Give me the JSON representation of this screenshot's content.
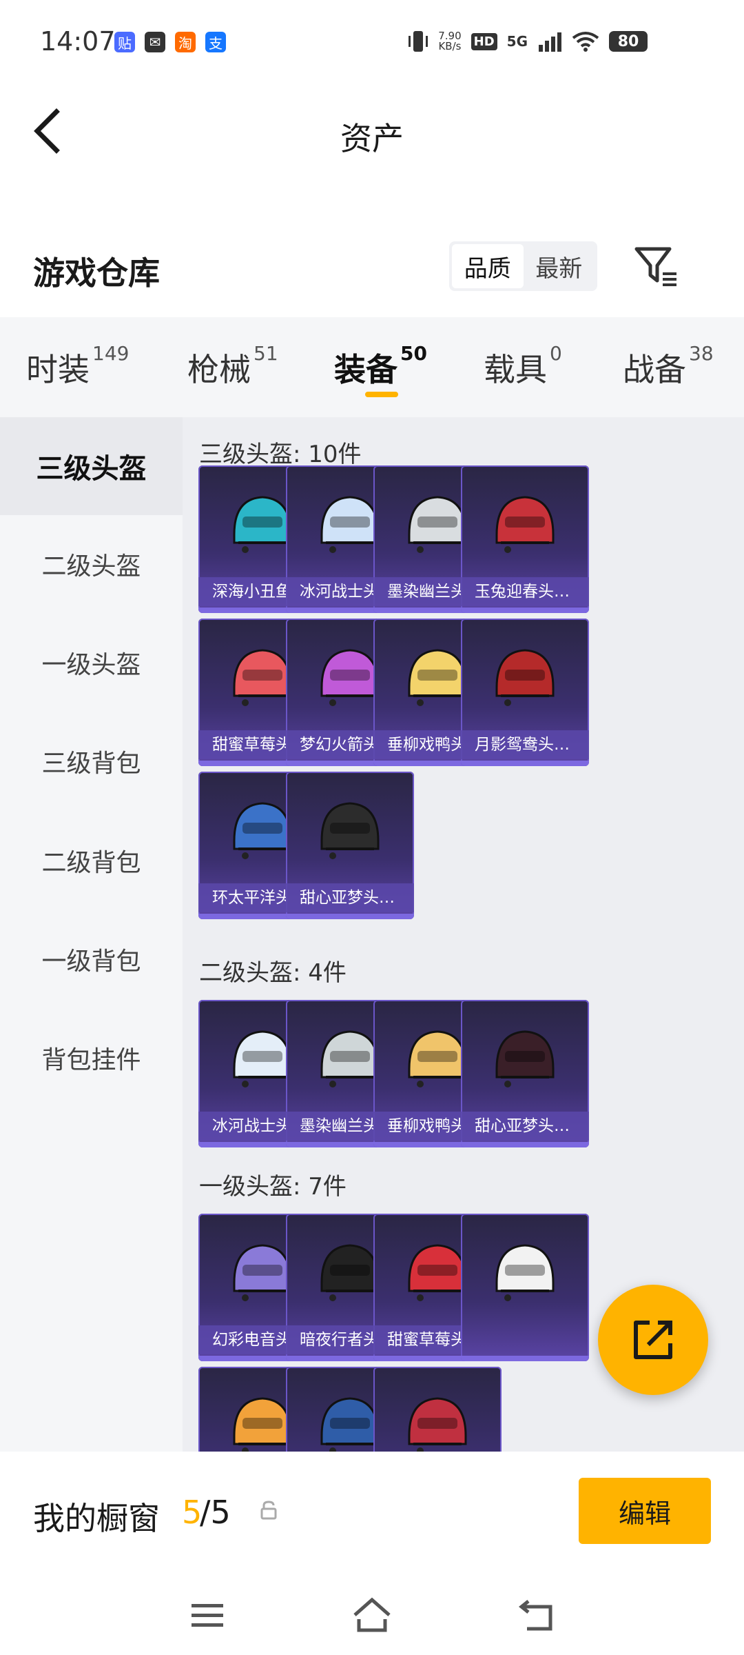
{
  "status_bar": {
    "time": "14:07",
    "apps": [
      {
        "icon": "tieba-icon",
        "color": "#4b6bff",
        "glyph": "贴"
      },
      {
        "icon": "mail-icon",
        "color": "#333333",
        "glyph": "✉"
      },
      {
        "icon": "taobao-icon",
        "color": "#ff6a00",
        "glyph": "淘"
      },
      {
        "icon": "alipay-icon",
        "color": "#1677ff",
        "glyph": "支"
      }
    ],
    "net_speed_value": "7.90",
    "net_speed_unit": "KB/s",
    "hd": "HD",
    "network": "5G",
    "battery": "80"
  },
  "header": {
    "title": "资产"
  },
  "warehouse": {
    "title": "游戏仓库",
    "sort_options": [
      "品质",
      "最新"
    ],
    "active_sort": "品质"
  },
  "tabs": [
    {
      "label": "时装",
      "count": "149"
    },
    {
      "label": "枪械",
      "count": "51"
    },
    {
      "label": "装备",
      "count": "50"
    },
    {
      "label": "载具",
      "count": "0"
    },
    {
      "label": "战备",
      "count": "38"
    }
  ],
  "active_tab": "装备",
  "categories": [
    "三级头盔",
    "二级头盔",
    "一级头盔",
    "三级背包",
    "二级背包",
    "一级背包",
    "背包挂件"
  ],
  "active_category": "三级头盔",
  "sections": [
    {
      "title": "三级头盔: 10件",
      "items": [
        {
          "label": "深海小丑鱼…",
          "color": "#2bb6c8"
        },
        {
          "label": "冰河战士头…",
          "color": "#cfe2f8"
        },
        {
          "label": "墨染幽兰头…",
          "color": "#d9dde0"
        },
        {
          "label": "玉兔迎春头…",
          "color": "#c8323a"
        },
        {
          "label": "甜蜜草莓头…",
          "color": "#e8585e"
        },
        {
          "label": "梦幻火箭头…",
          "color": "#c05ad8"
        },
        {
          "label": "垂柳戏鸭头…",
          "color": "#f3d36b"
        },
        {
          "label": "月影鸳鸯头…",
          "color": "#b52a2a"
        },
        {
          "label": "环太平洋头…",
          "color": "#3b72c8"
        },
        {
          "label": "甜心亚梦头…",
          "color": "#2c2c2c"
        }
      ]
    },
    {
      "title": "二级头盔: 4件",
      "items": [
        {
          "label": "冰河战士头…",
          "color": "#e4eef8"
        },
        {
          "label": "墨染幽兰头…",
          "color": "#cfd6d8"
        },
        {
          "label": "垂柳戏鸭头…",
          "color": "#f0c46a"
        },
        {
          "label": "甜心亚梦头…",
          "color": "#3a1f28"
        }
      ]
    },
    {
      "title": "一级头盔: 7件",
      "items": [
        {
          "label": "幻彩电音头…",
          "color": "#8a7ad8"
        },
        {
          "label": "暗夜行者头…",
          "color": "#222222"
        },
        {
          "label": "甜蜜草莓头…",
          "color": "#d8303a"
        },
        {
          "label": "",
          "color": "#f2f2f2"
        },
        {
          "label": "",
          "color": "#f2a23a"
        },
        {
          "label": "",
          "color": "#2f5da8"
        },
        {
          "label": "",
          "color": "#c03040"
        }
      ]
    }
  ],
  "showcase": {
    "label": "我的橱窗",
    "current": "5",
    "total": "/5",
    "edit_label": "编辑"
  },
  "colors": {
    "accent": "#ffb300",
    "card_bg": "#3b2f6e",
    "card_label_bg": "#5a48aa"
  }
}
